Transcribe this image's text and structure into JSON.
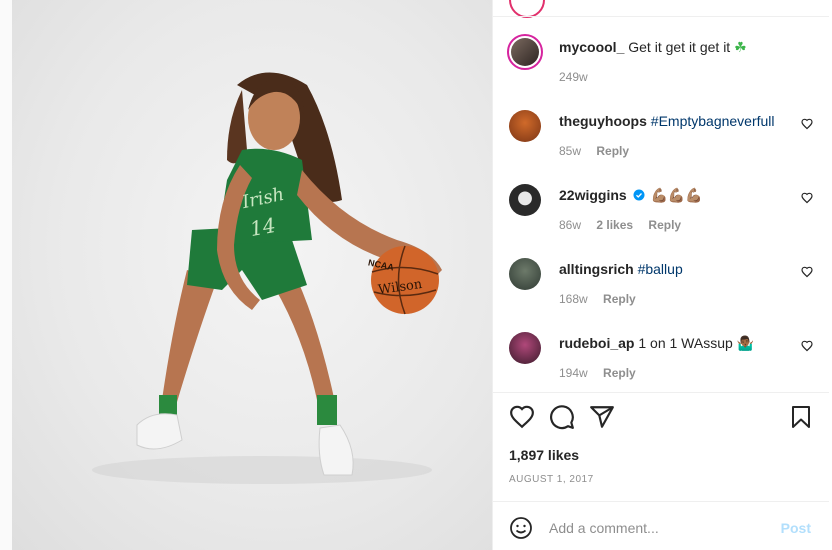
{
  "post": {
    "image_alt": "Basketball player in green Irish #14 uniform dribbling a Wilson basketball",
    "jersey_text": "Irish",
    "jersey_number": "14",
    "ball_text": "Wilson",
    "ball_ncaa": "NCAA"
  },
  "comments": [
    {
      "username": "mycoool_",
      "text": "Get it get it get it",
      "emoji": "☘",
      "time": "249w"
    },
    {
      "username": "theguyhoops",
      "text": "#Emptybagneverfull",
      "time": "85w",
      "reply": "Reply"
    },
    {
      "username": "22wiggins",
      "emoji": "💪🏽💪🏽💪🏽",
      "time": "86w",
      "likes": "2 likes",
      "reply": "Reply"
    },
    {
      "username": "alltingsrich",
      "text": "#ballup",
      "time": "168w",
      "reply": "Reply"
    },
    {
      "username": "rudeboi_ap",
      "text": "1 on 1 WAssup",
      "emoji": "🤷🏾‍♂️",
      "time": "194w",
      "reply": "Reply"
    }
  ],
  "likes_count": "1,897 likes",
  "post_date": "AUGUST 1, 2017",
  "add_comment": {
    "placeholder": "Add a comment...",
    "post_label": "Post"
  },
  "colors": {
    "link": "#00376b",
    "muted": "#8e8e8e",
    "post_disabled": "#b2dffc",
    "ring": "#d6249f",
    "verified": "#0095f6",
    "jersey_green": "#1f7a3a"
  }
}
